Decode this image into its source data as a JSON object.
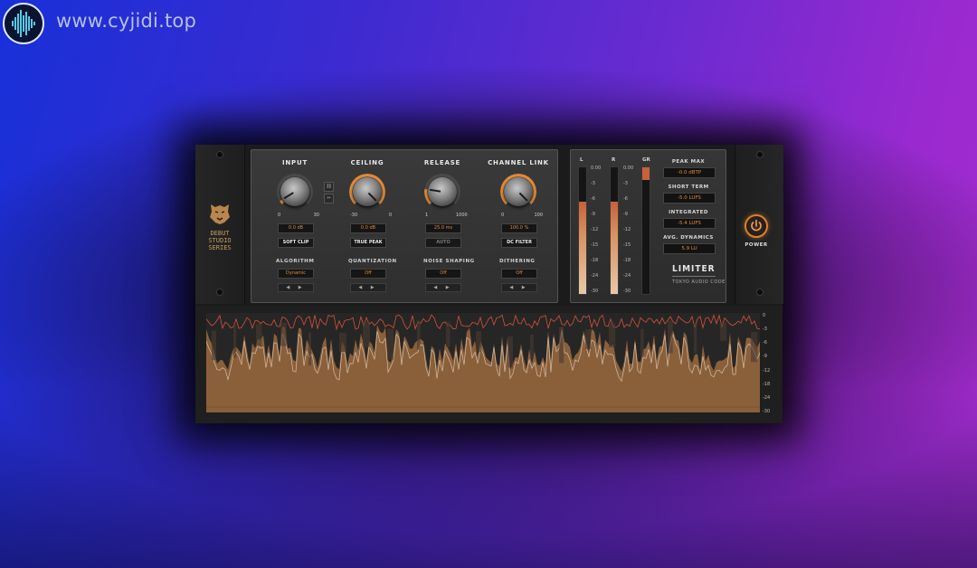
{
  "watermark": {
    "site": "www.cyjidi.top"
  },
  "brand": {
    "line1": "DEBUT",
    "line2": "STUDIO",
    "line3": "SERIES"
  },
  "columns": [
    {
      "title": "INPUT",
      "min": "0",
      "max": "30",
      "value": "0.0 dB",
      "button": "SOFT CLIP",
      "button_on": true,
      "sub": "ALGORITHM",
      "select": "Dynamic",
      "knob_level": 0.05
    },
    {
      "title": "CEILING",
      "min": "-30",
      "max": "0",
      "value": "0.0 dB",
      "button": "TRUE PEAK",
      "button_on": true,
      "sub": "QUANTIZATION",
      "select": "Off",
      "knob_level": 1.0
    },
    {
      "title": "RELEASE",
      "min": "1",
      "max": "1000",
      "value": "25.0 ms",
      "button": "AUTO",
      "button_on": false,
      "sub": "NOISE SHAPING",
      "select": "Off",
      "knob_level": 0.2
    },
    {
      "title": "CHANNEL LINK",
      "min": "0",
      "max": "100",
      "value": "100.0 %",
      "button": "DC FILTER",
      "button_on": true,
      "sub": "DITHERING",
      "select": "Off",
      "knob_level": 1.0
    }
  ],
  "link_buttons": [
    "⛓",
    "↔"
  ],
  "meters": {
    "labels": {
      "l": "L",
      "r": "R",
      "gr": "GR"
    },
    "scale": [
      "0.00",
      "-3",
      "-6",
      "-9",
      "-12",
      "-15",
      "-18",
      "-24",
      "-30"
    ],
    "scale_r": [
      "0.00",
      "-3",
      "-6",
      "-9",
      "-12",
      "-15",
      "-18",
      "-24",
      "-30"
    ],
    "l_level": 0.73,
    "r_level": 0.73,
    "gr_level": 0.1
  },
  "stats": [
    {
      "label": "PEAK MAX",
      "value": "-0.0 dBTP"
    },
    {
      "label": "SHORT TERM",
      "value": "-5.0 LUFS"
    },
    {
      "label": "INTEGRATED",
      "value": "-5.4 LUFS"
    },
    {
      "label": "AVG. DYNAMICS",
      "value": "5.9 LU"
    }
  ],
  "product": {
    "name": "LIMITER",
    "maker": "TOKYO AUDIO CODE"
  },
  "power": {
    "label": "POWER"
  },
  "wave_scale": [
    "0",
    "-3",
    "-6",
    "-9",
    "-12",
    "-18",
    "-24",
    "-30"
  ],
  "colors": {
    "accent": "#e08a3a",
    "panel": "#333333",
    "wave_fill": "#9c6b40",
    "wave_peak": "#d8503a"
  }
}
